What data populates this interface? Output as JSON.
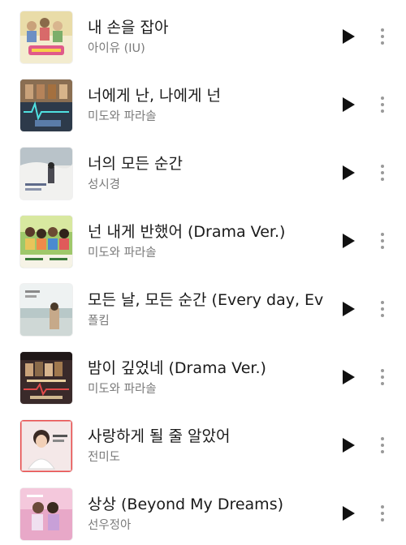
{
  "colors": {
    "title_text": "#1a1a1a",
    "artist_text": "#7a7a7a",
    "play_icon": "#111111",
    "more_icon": "#9a9a9a"
  },
  "tracks": [
    {
      "title": "내 손을 잡아",
      "artist": "아이유 (IU)"
    },
    {
      "title": "너에게 난, 나에게 넌",
      "artist": "미도와 파라솔"
    },
    {
      "title": "너의 모든 순간",
      "artist": "성시경"
    },
    {
      "title": "넌 내게 반했어 (Drama Ver.)",
      "artist": "미도와 파라솔"
    },
    {
      "title": "모든 날, 모든 순간 (Every day, Ever..",
      "artist": "폴킴"
    },
    {
      "title": "밤이 깊었네 (Drama Ver.)",
      "artist": "미도와 파라솔"
    },
    {
      "title": "사랑하게 될 줄 알았어",
      "artist": "전미도"
    },
    {
      "title": "상상 (Beyond My Dreams)",
      "artist": "선우정아"
    }
  ]
}
